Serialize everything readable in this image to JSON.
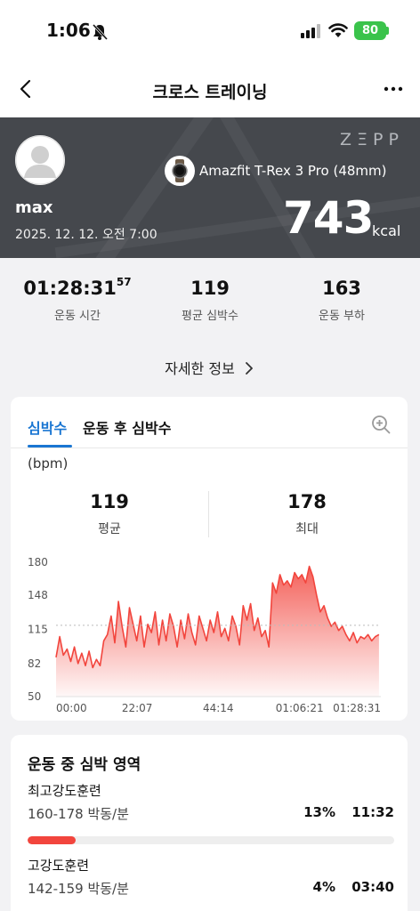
{
  "status_bar": {
    "time": "1:06",
    "battery": "80"
  },
  "nav": {
    "title": "크로스 트레이닝"
  },
  "hero": {
    "brand": "ZΞPP",
    "username": "max",
    "date": "2025. 12. 12. 오전 7:00",
    "device": "Amazfit T-Rex 3 Pro (48mm)",
    "calories": "743",
    "calories_unit": "kcal"
  },
  "summary": {
    "stats": [
      {
        "value": "01:28:31",
        "suffix": "57",
        "label": "운동 시간"
      },
      {
        "value": "119",
        "suffix": "",
        "label": "평균 심박수"
      },
      {
        "value": "163",
        "suffix": "",
        "label": "운동 부하"
      }
    ],
    "details_label": "자세한 정보"
  },
  "heart_rate": {
    "tab_active": "심박수",
    "tab_inactive": "운동 후 심박수",
    "unit": "(bpm)",
    "average": {
      "value": "119",
      "label": "평균"
    },
    "max": {
      "value": "178",
      "label": "최대"
    }
  },
  "chart_data": {
    "type": "area",
    "ylabel": "(bpm)",
    "ylim": [
      50,
      180
    ],
    "yticks": [
      "180",
      "148",
      "115",
      "82",
      "50"
    ],
    "xticks": [
      "00:00",
      "22:07",
      "44:14",
      "01:06:21",
      "01:28:31"
    ],
    "reference_line": 119,
    "x_minutes_max": 88.5,
    "color": "#f2453d",
    "x": [
      0,
      1,
      2,
      3,
      4,
      5,
      6,
      7,
      8,
      9,
      10,
      11,
      12,
      13,
      14,
      15,
      16,
      17,
      18,
      19,
      20,
      21,
      22,
      23,
      24,
      25,
      26,
      27,
      28,
      29,
      30,
      31,
      32,
      33,
      34,
      35,
      36,
      37,
      38,
      39,
      40,
      41,
      42,
      43,
      44,
      45,
      46,
      47,
      48,
      49,
      50,
      51,
      52,
      53,
      54,
      55,
      56,
      57,
      58,
      59,
      60,
      61,
      62,
      63,
      64,
      65,
      66,
      67,
      68,
      69,
      70,
      71,
      72,
      73,
      74,
      75,
      76,
      77,
      78,
      79,
      80,
      81,
      82,
      83,
      84,
      85,
      86,
      87,
      88
    ],
    "y": [
      88,
      108,
      90,
      96,
      84,
      98,
      82,
      92,
      80,
      94,
      78,
      86,
      80,
      104,
      110,
      128,
      102,
      142,
      118,
      98,
      136,
      120,
      104,
      128,
      98,
      120,
      112,
      132,
      100,
      124,
      104,
      130,
      118,
      98,
      124,
      106,
      130,
      112,
      100,
      128,
      116,
      104,
      124,
      112,
      132,
      108,
      116,
      104,
      128,
      118,
      100,
      138,
      124,
      140,
      114,
      126,
      108,
      114,
      98,
      160,
      150,
      168,
      158,
      162,
      156,
      170,
      164,
      168,
      160,
      176,
      166,
      148,
      132,
      138,
      126,
      118,
      122,
      114,
      118,
      110,
      104,
      112,
      102,
      108,
      106,
      110,
      104,
      108,
      110
    ]
  },
  "zones": {
    "title": "운동 중 심박 영역",
    "items": [
      {
        "name": "최고강도훈련",
        "range": "160-178 박동/분",
        "percent": "13%",
        "duration": "11:32",
        "fraction": 0.13,
        "color": "#f2453d"
      },
      {
        "name": "고강도훈련",
        "range": "142-159 박동/분",
        "percent": "4%",
        "duration": "03:40",
        "fraction": 0.04,
        "color": "#f5a623"
      }
    ]
  }
}
